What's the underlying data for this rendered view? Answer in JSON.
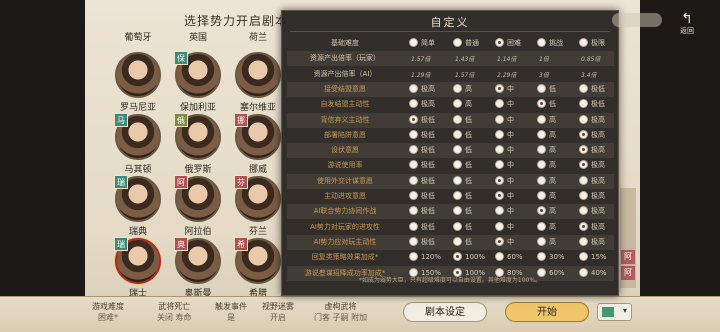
{
  "screen": {
    "title": "选择势力开启剧本",
    "back_label": "返回",
    "factions": [
      {
        "name": "葡萄牙",
        "flag": ""
      },
      {
        "name": "英国",
        "flag": ""
      },
      {
        "name": "荷兰",
        "flag": ""
      },
      {
        "name": "罗马尼亚",
        "flag": "",
        "flag_color": ""
      },
      {
        "name": "保加利亚",
        "flag": "保",
        "flag_color": "#3d8a78"
      },
      {
        "name": "塞尔维亚",
        "flag": "",
        "flag_color": ""
      },
      {
        "name": "马其顿",
        "flag": "马",
        "flag_color": "#3d8a78"
      },
      {
        "name": "俄罗斯",
        "flag": "俄",
        "flag_color": "#7c8a48"
      },
      {
        "name": "挪威",
        "flag": "挪",
        "flag_color": "#b1504f"
      },
      {
        "name": "瑞典",
        "flag": "瑞",
        "flag_color": "#3d8a78"
      },
      {
        "name": "阿拉伯",
        "flag": "阿",
        "flag_color": "#b1504f"
      },
      {
        "name": "芬兰",
        "flag": "芬",
        "flag_color": "#b1504f"
      },
      {
        "name": "瑞士",
        "flag": "瑞",
        "flag_color": "#3d8a78"
      },
      {
        "name": "奥斯曼",
        "flag": "奥",
        "flag_color": "#b1504f"
      },
      {
        "name": "希腊",
        "flag": "希",
        "flag_color": "#b1504f"
      }
    ],
    "right_seals": [
      "阿",
      "阿"
    ]
  },
  "bottom_bar": {
    "items": [
      {
        "key": "游戏难度",
        "value": "困难*"
      },
      {
        "key": "武将死亡",
        "value": "关闭 寿命"
      },
      {
        "key": "触发事件",
        "value": "是"
      },
      {
        "key": "视野迷雾",
        "value": "开启"
      },
      {
        "key": "虚构武将",
        "value": "门客 子嗣 附加"
      }
    ],
    "custom_button": "剧本设定",
    "start_button": "开始",
    "player_color": "#3f9a6f"
  },
  "dialog": {
    "title": "自定义",
    "difficulty": {
      "label": "基础难度",
      "options": [
        "简单",
        "普通",
        "困难",
        "挑战",
        "极限"
      ],
      "selected": 2,
      "player_rate_label": "资源产出倍率（玩家）",
      "player_rates": [
        "1.57倍",
        "1.43倍",
        "1.14倍",
        "1倍",
        "0.85倍"
      ],
      "ai_rate_label": "资源产出倍率（AI）",
      "ai_rates": [
        "1.29倍",
        "1.57倍",
        "2.29倍",
        "3倍",
        "3.4倍"
      ]
    },
    "level_rows": [
      {
        "label": "接受结盟意愿",
        "options": [
          "极高",
          "高",
          "中",
          "低",
          "极低"
        ],
        "selected": 2
      },
      {
        "label": "自发结盟主动性",
        "options": [
          "极高",
          "高",
          "中",
          "低",
          "极低"
        ],
        "selected": 3
      },
      {
        "label": "背信弃义主动性",
        "options": [
          "极低",
          "低",
          "中",
          "高",
          "极高"
        ],
        "selected": 0
      },
      {
        "label": "部署陷阱意愿",
        "options": [
          "极低",
          "低",
          "中",
          "高",
          "极高"
        ],
        "selected": 4
      },
      {
        "label": "设伏意愿",
        "options": [
          "极低",
          "低",
          "中",
          "高",
          "极高"
        ],
        "selected": 4
      },
      {
        "label": "游说使用率",
        "options": [
          "极低",
          "低",
          "中",
          "高",
          "极高"
        ],
        "selected": 4
      },
      {
        "label": "使用外交计谋意愿",
        "options": [
          "极低",
          "低",
          "中",
          "高",
          "极高"
        ],
        "selected": 2
      },
      {
        "label": "主动进攻意愿",
        "options": [
          "极低",
          "低",
          "中",
          "高",
          "极高"
        ],
        "selected": 2
      },
      {
        "label": "AI联合势力协同作战",
        "options": [
          "极低",
          "低",
          "中",
          "高",
          "极高"
        ],
        "selected": 3
      },
      {
        "label": "AI势力对玩家的进攻性",
        "options": [
          "极低",
          "低",
          "中",
          "高",
          "极高"
        ],
        "selected": 4
      },
      {
        "label": "AI势力应对玩主动性",
        "options": [
          "极低",
          "低",
          "中",
          "高",
          "极高"
        ],
        "selected": 2
      }
    ],
    "percent_rows": [
      {
        "label": "回复类策略效果加成*",
        "options": [
          "120%",
          "100%",
          "60%",
          "30%",
          "15%"
        ],
        "selected": 1
      },
      {
        "label": "游说叁谋招降成功率加成*",
        "options": [
          "150%",
          "100%",
          "80%",
          "60%",
          "40%"
        ],
        "selected": 1
      }
    ],
    "footnote": "*如成为弱势大臣，只有超级难度可以自由设置。其他难度为100%。"
  }
}
